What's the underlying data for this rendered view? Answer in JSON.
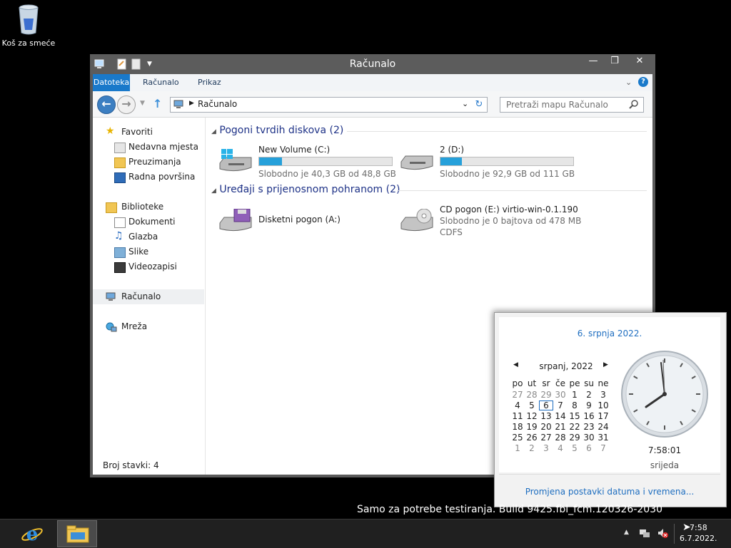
{
  "desktop": {
    "recycle_bin_label": "Koš za smeće"
  },
  "window": {
    "title": "Računalo",
    "ribbon_tabs": [
      "Datoteka",
      "Računalo",
      "Prikaz"
    ],
    "address": "Računalo",
    "search_placeholder": "Pretraži mapu Računalo",
    "nav": {
      "favorites": "Favoriti",
      "recent": "Nedavna mjesta",
      "downloads": "Preuzimanja",
      "desktop": "Radna površina",
      "libraries": "Biblioteke",
      "documents": "Dokumenti",
      "music": "Glazba",
      "pictures": "Slike",
      "videos": "Videozapisi",
      "computer": "Računalo",
      "network": "Mreža"
    },
    "groups": {
      "hdd": "Pogoni tvrdih diskova (2)",
      "removable": "Uređaji s prijenosnom pohranom (2)"
    },
    "drives": [
      {
        "name": "New Volume (C:)",
        "free": "Slobodno je 40,3 GB od 48,8 GB",
        "used_fraction": 0.17
      },
      {
        "name": "2 (D:)",
        "free": "Slobodno je 92,9 GB od 111 GB",
        "used_fraction": 0.16
      }
    ],
    "devices": [
      {
        "name": "Disketni pogon (A:)"
      },
      {
        "name": "CD pogon (E:) virtio-win-0.1.190",
        "free": "Slobodno je 0 bajtova od 478 MB",
        "fs": "CDFS"
      }
    ],
    "status": "Broj stavki: 4"
  },
  "calendar": {
    "date_link": "6. srpnja 2022.",
    "month": "srpanj, 2022",
    "weekdays": [
      "po",
      "ut",
      "sr",
      "če",
      "pe",
      "su",
      "ne"
    ],
    "weeks": [
      [
        "27",
        "28",
        "29",
        "30",
        "1",
        "2",
        "3"
      ],
      [
        "4",
        "5",
        "6",
        "7",
        "8",
        "9",
        "10"
      ],
      [
        "11",
        "12",
        "13",
        "14",
        "15",
        "16",
        "17"
      ],
      [
        "18",
        "19",
        "20",
        "21",
        "22",
        "23",
        "24"
      ],
      [
        "25",
        "26",
        "27",
        "28",
        "29",
        "30",
        "31"
      ],
      [
        "1",
        "2",
        "3",
        "4",
        "5",
        "6",
        "7"
      ]
    ],
    "time": "7:58:01",
    "weekday_name": "srijeda",
    "settings_link": "Promjena postavki datuma i vremena..."
  },
  "watermark": "Samo za potrebe testiranja. Build 9425.fbl_fcm.120326-2030",
  "taskbar": {
    "time": "7:58",
    "date": "6.7.2022."
  },
  "colors": {
    "accent": "#1979ca",
    "link": "#1e6ec0",
    "drive_fill": "#26a0da"
  }
}
